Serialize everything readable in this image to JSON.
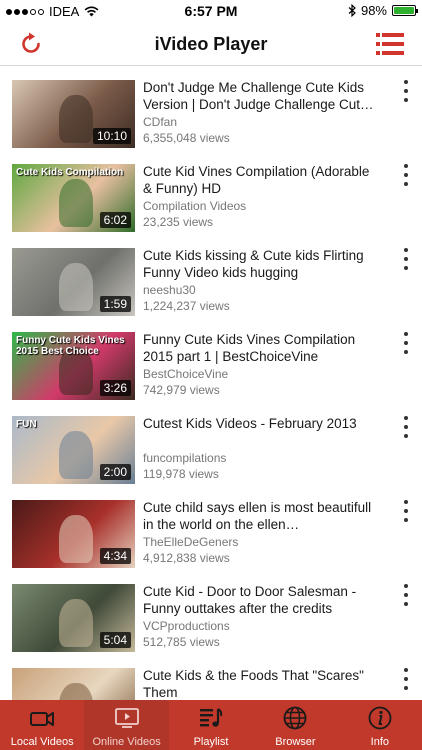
{
  "status_bar": {
    "carrier": "IDEA",
    "time": "6:57 PM",
    "battery_percent": "98%",
    "battery_level": 0.98
  },
  "nav": {
    "title": "iVideo Player"
  },
  "colors": {
    "accent": "#c0392b",
    "tab_active_bg": "#b0362a"
  },
  "videos": [
    {
      "title": "Don't Judge Me Challenge Cute Kids Version | Don't Judge Challenge Cut…",
      "channel": "CDfan",
      "views": "6,355,048 views",
      "duration": "10:10",
      "thumb_colors": [
        "#d8c6b3",
        "#7a5a48",
        "#3d2d25"
      ]
    },
    {
      "title": "Cute Kid Vines Compilation (Adorable & Funny) HD",
      "channel": "Compilation Videos",
      "views": "23,235 views",
      "duration": "6:02",
      "thumb_colors": [
        "#5ea840",
        "#e8c0a0",
        "#2f6b2a"
      ],
      "thumb_text": [
        "Cute",
        "Kids",
        "Compilation"
      ]
    },
    {
      "title": "Cute Kids kissing & Cute kids Flirting Funny Video kids hugging",
      "channel": "neeshu30",
      "views": "1,224,237 views",
      "duration": "1:59",
      "thumb_colors": [
        "#9a9a92",
        "#6f706c",
        "#c9c6bf"
      ]
    },
    {
      "title": "Funny Cute Kids Vines Compilation 2015 part 1 | BestChoiceVine",
      "channel": "BestChoiceVine",
      "views": "742,979 views",
      "duration": "3:26",
      "thumb_colors": [
        "#2fb84a",
        "#d23a6a",
        "#3a2a20"
      ],
      "thumb_text": [
        "Funny",
        "Cute",
        "Kids",
        "Vines",
        "2015",
        "Best",
        "Choice"
      ]
    },
    {
      "title": "Cutest Kids Videos - February 2013",
      "channel": "funcompilations",
      "views": "119,978 views",
      "duration": "2:00",
      "thumb_colors": [
        "#aab9c9",
        "#e8c8a8",
        "#6a7f95"
      ],
      "thumb_text": [
        "FUN"
      ]
    },
    {
      "title": "Cute child says ellen is most beautifull in the world on the ellen…",
      "channel": "TheElleDeGeners",
      "views": "4,912,838 views",
      "duration": "4:34",
      "thumb_colors": [
        "#4a1a18",
        "#a8302a",
        "#e6d2c0"
      ]
    },
    {
      "title": "Cute Kid - Door to Door Salesman - Funny outtakes after the credits",
      "channel": "VCPproductions",
      "views": "512,785 views",
      "duration": "5:04",
      "thumb_colors": [
        "#7a8a70",
        "#3f4a38",
        "#c6b89a"
      ]
    },
    {
      "title": "Cute Kids & the Foods That \"Scares\" Them",
      "channel": "",
      "views": "",
      "duration": "",
      "thumb_colors": [
        "#c9a27a",
        "#e8d7c0",
        "#7a5a3a"
      ]
    }
  ],
  "tabs": [
    {
      "label": "Local Videos",
      "icon": "video-camera-icon"
    },
    {
      "label": "Online Videos",
      "icon": "tv-play-icon"
    },
    {
      "label": "Playlist",
      "icon": "playlist-music-icon"
    },
    {
      "label": "Browser",
      "icon": "globe-icon"
    },
    {
      "label": "Info",
      "icon": "info-icon"
    }
  ],
  "active_tab": 1
}
